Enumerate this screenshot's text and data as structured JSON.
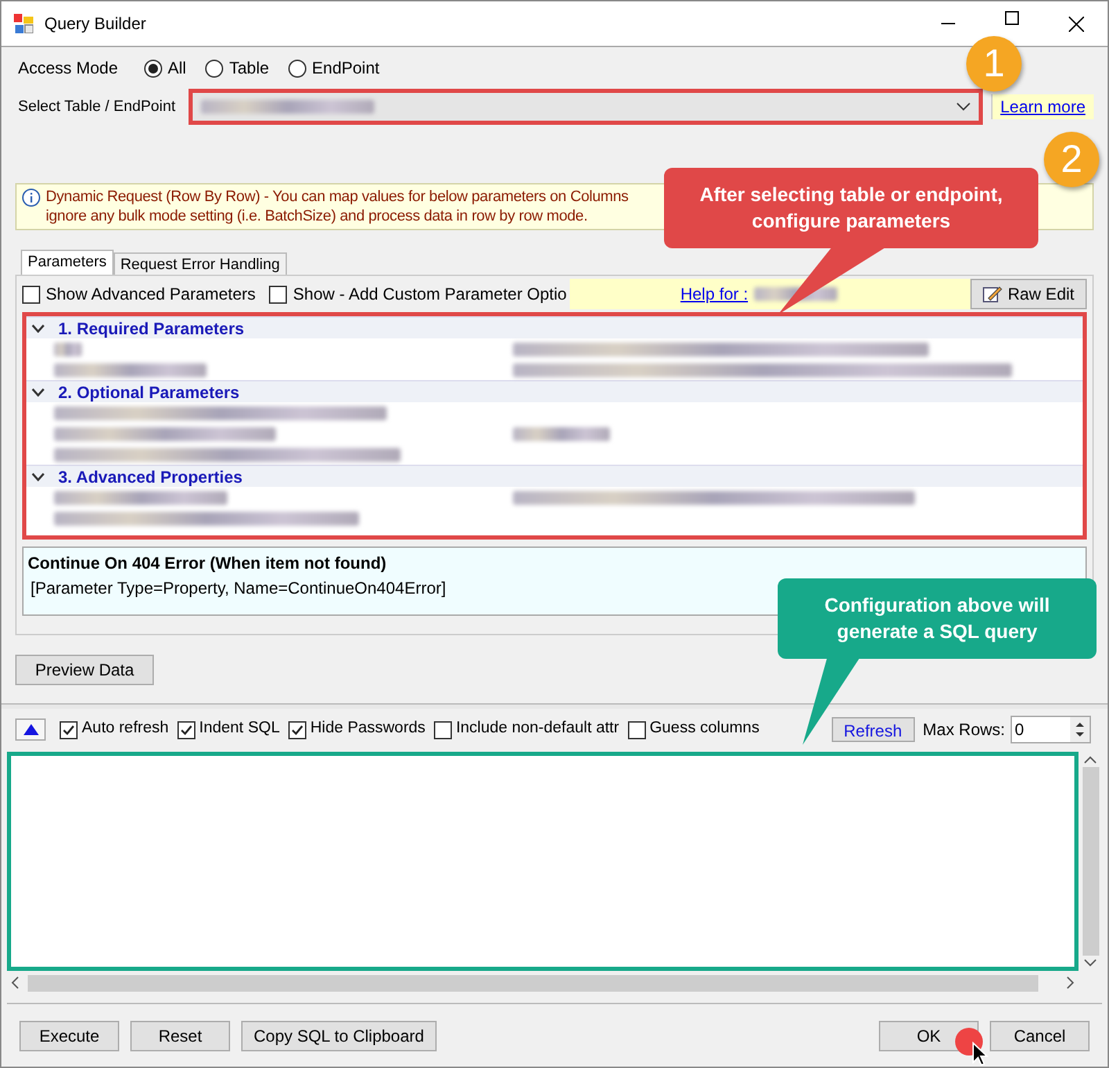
{
  "window": {
    "title": "Query Builder"
  },
  "access_mode": {
    "label": "Access Mode",
    "options": [
      {
        "label": "All",
        "selected": true
      },
      {
        "label": "Table",
        "selected": false
      },
      {
        "label": "EndPoint",
        "selected": false
      }
    ]
  },
  "select": {
    "label": "Select Table / EndPoint",
    "highlighted": true
  },
  "learn_more": "Learn more",
  "info": {
    "lines": [
      "Dynamic Request (Row By Row) - You can map values for below parameters on Columns",
      "ignore any bulk mode setting (i.e. BatchSize) and process data in row by row mode."
    ]
  },
  "tabs": [
    {
      "label": "Parameters",
      "selected": true
    },
    {
      "label": "Request Error Handling",
      "selected": false
    }
  ],
  "options": [
    {
      "label": "Show Advanced Parameters",
      "checked": false
    },
    {
      "label": "Show - Add Custom Parameter Optio",
      "checked": false
    }
  ],
  "help_link": "Help for :",
  "raw_edit": "Raw Edit",
  "grid": {
    "highlighted": true,
    "groups": [
      {
        "title": "1. Required Parameters",
        "expanded": true
      },
      {
        "title": "2. Optional Parameters",
        "expanded": true
      },
      {
        "title": "3. Advanced Properties",
        "expanded": true
      }
    ]
  },
  "description": {
    "title": "Continue On 404 Error (When item not found)",
    "detail": "[Parameter Type=Property, Name=ContinueOn404Error]"
  },
  "preview_button": "Preview Data",
  "sql_toolbar": {
    "options": [
      {
        "label": "Auto refresh",
        "checked": true
      },
      {
        "label": "Indent SQL",
        "checked": true
      },
      {
        "label": "Hide Passwords",
        "checked": true
      },
      {
        "label": "Include non-default attr",
        "checked": false
      },
      {
        "label": "Guess columns",
        "checked": false
      }
    ],
    "refresh": "Refresh",
    "max_rows": {
      "label": "Max Rows:",
      "value": "0"
    }
  },
  "sql_editor": {
    "highlighted": true
  },
  "footer": {
    "left": [
      "Execute",
      "Reset",
      "Copy SQL to Clipboard"
    ],
    "right": [
      "OK",
      "Cancel"
    ]
  },
  "annotations": [
    {
      "number": "1",
      "color": "#f5a623"
    },
    {
      "number": "2",
      "color": "#f5a623"
    }
  ],
  "callouts": [
    {
      "text": "After selecting table or endpoint, configure parameters",
      "color": "#e04848"
    },
    {
      "text": "Configuration above will generate a SQL query",
      "color": "#17a98a"
    }
  ]
}
